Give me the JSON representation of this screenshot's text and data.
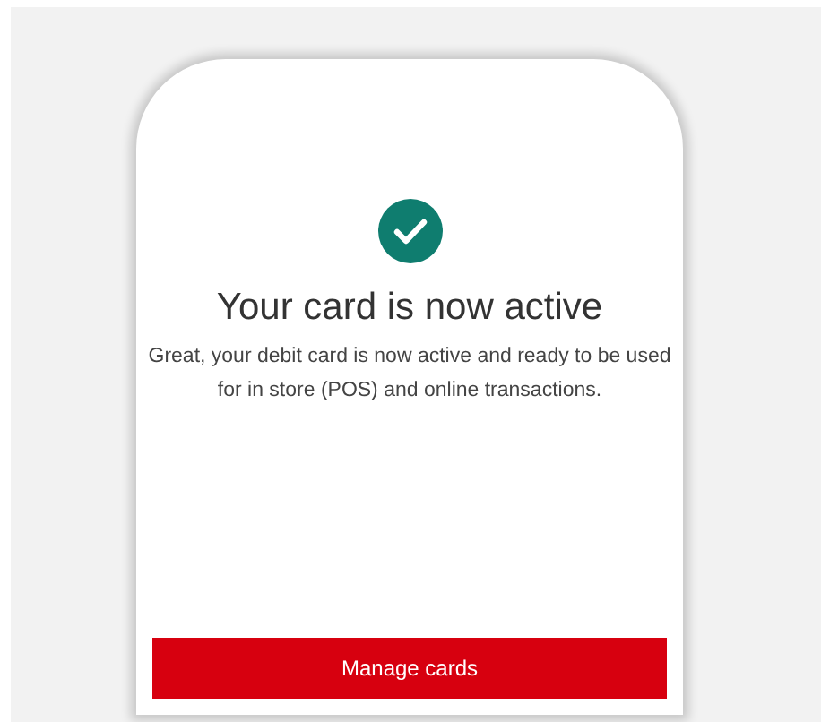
{
  "confirmation": {
    "title": "Your card is now active",
    "message": "Great, your debit card is now active and ready to be used for in store (POS) and online transactions."
  },
  "buttons": [
    {
      "label": "Manage cards",
      "kind": "primary"
    }
  ]
}
